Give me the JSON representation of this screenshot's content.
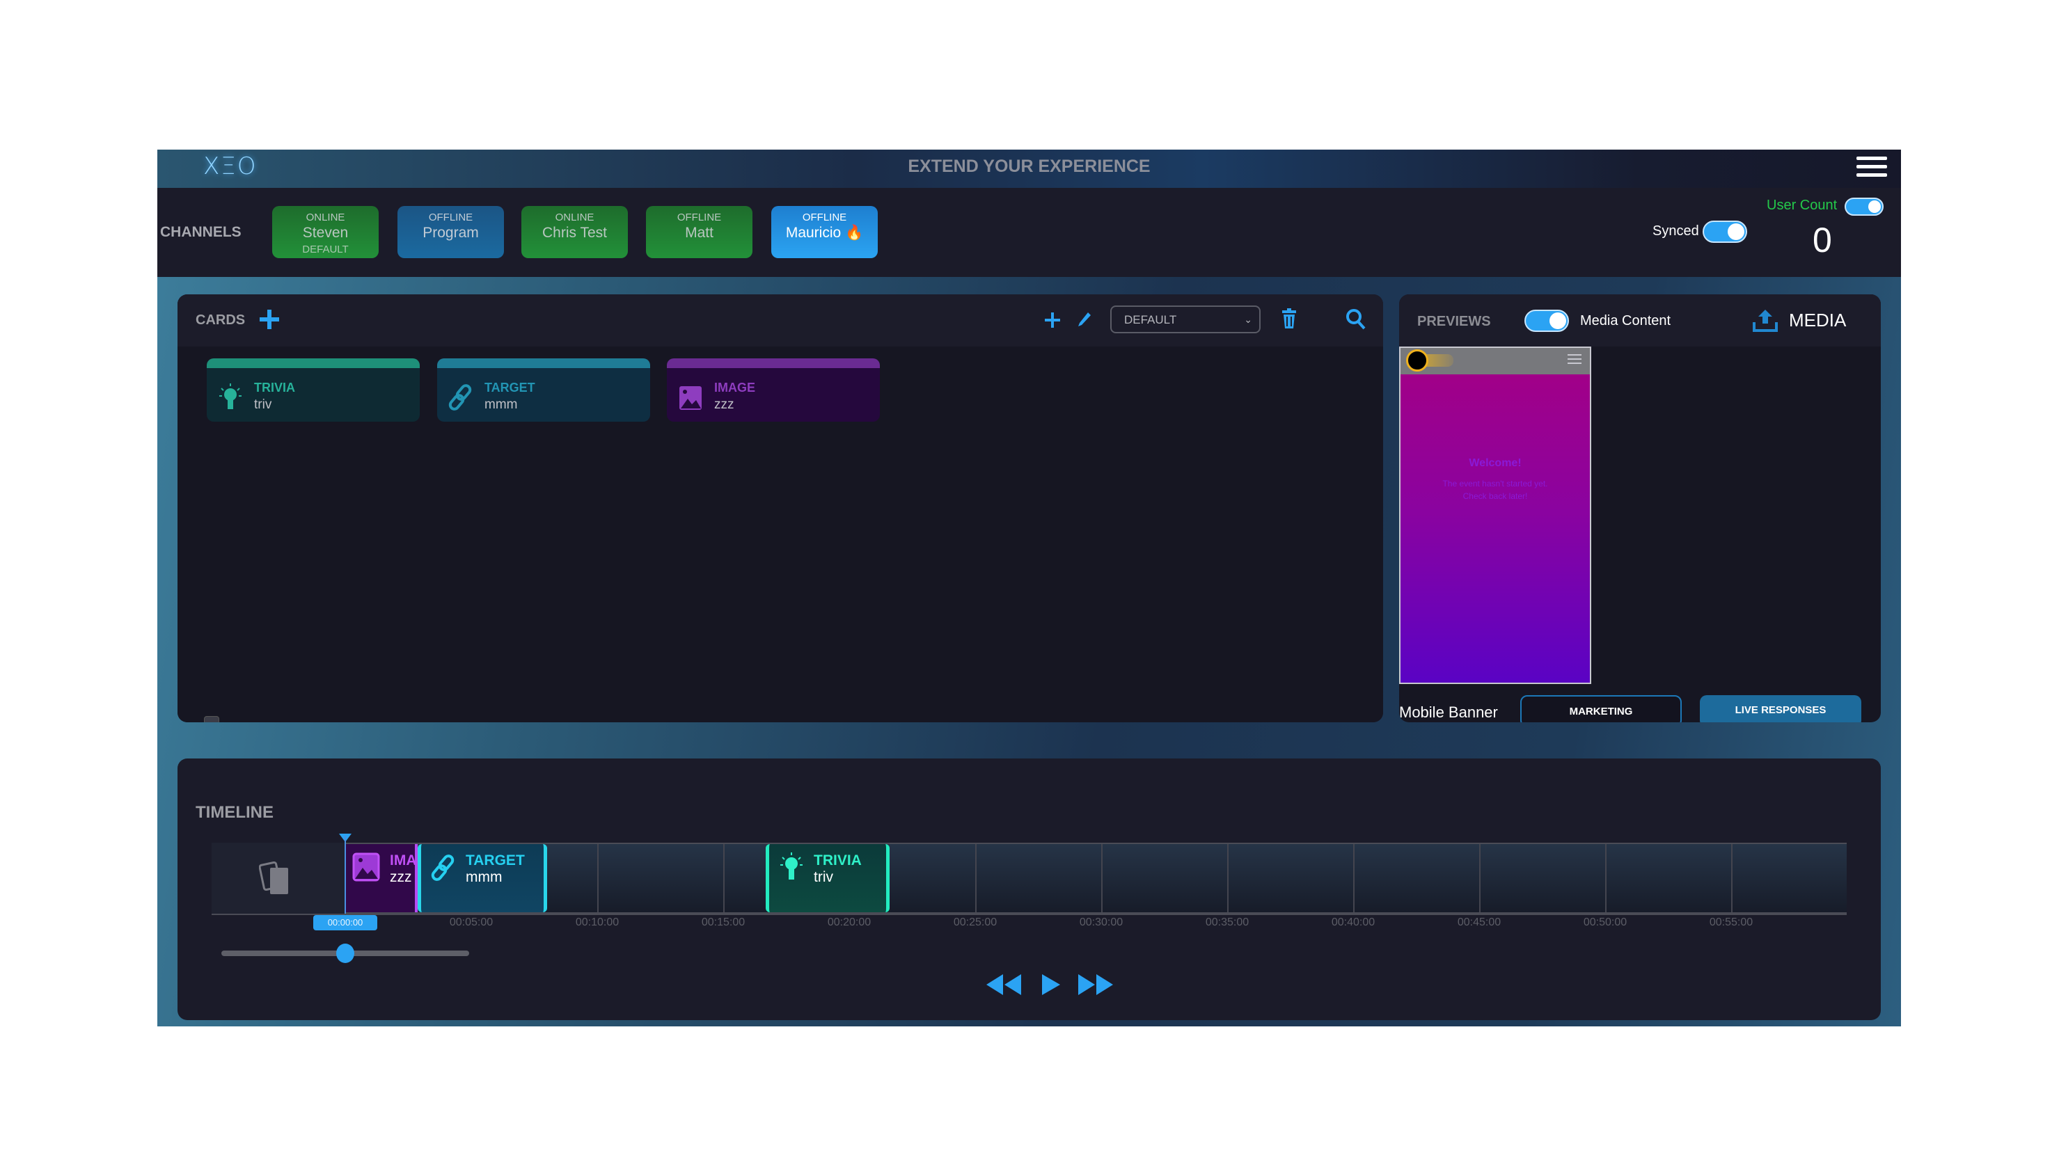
{
  "header": {
    "logo": "XΞO",
    "title": "EXTEND YOUR EXPERIENCE"
  },
  "channels": {
    "label": "CHANNELS",
    "items": [
      {
        "status": "ONLINE",
        "name": "Steven",
        "badge": "DEFAULT",
        "color": "green"
      },
      {
        "status": "OFFLINE",
        "name": "Program",
        "badge": "",
        "color": "blue"
      },
      {
        "status": "ONLINE",
        "name": "Chris Test",
        "badge": "",
        "color": "green"
      },
      {
        "status": "OFFLINE",
        "name": "Matt",
        "badge": "",
        "color": "green"
      },
      {
        "status": "OFFLINE",
        "name": "Mauricio 🔥",
        "badge": "",
        "color": "active"
      }
    ],
    "synced_label": "Synced",
    "synced_on": true,
    "user_count_label": "User Count",
    "user_count_on": true,
    "user_count_value": "0"
  },
  "cards": {
    "label": "CARDS",
    "select_value": "DEFAULT",
    "items": [
      {
        "type": "TRIVIA",
        "name": "triv",
        "icon": "lightbulb-icon"
      },
      {
        "type": "TARGET",
        "name": "mmm",
        "icon": "link-icon"
      },
      {
        "type": "IMAGE",
        "name": "zzz",
        "icon": "image-icon"
      }
    ]
  },
  "previews": {
    "label": "PREVIEWS",
    "media_content_label": "Media Content",
    "media_content_on": true,
    "media_label": "MEDIA",
    "phone": {
      "welcome": "Welcome!",
      "message_line1": "The event hasn't started yet.",
      "message_line2": "Check back later!"
    },
    "mobile_banner_label": "Mobile Banner",
    "marketing_label": "MARKETING",
    "live_responses_label": "LIVE RESPONSES"
  },
  "timeline": {
    "label": "TIMELINE",
    "current_time": "00:00:00",
    "ticks": [
      "00:05:00",
      "00:10:00",
      "00:15:00",
      "00:20:00",
      "00:25:00",
      "00:30:00",
      "00:35:00",
      "00:40:00",
      "00:45:00",
      "00:50:00",
      "00:55:00"
    ],
    "clips": [
      {
        "type": "IMAGE",
        "type_visible": "IMA",
        "name": "zzz",
        "kind": "image"
      },
      {
        "type": "TARGET",
        "name": "mmm",
        "kind": "target"
      },
      {
        "type": "TRIVIA",
        "name": "triv",
        "kind": "trivia"
      }
    ],
    "zoom_level": 0.5
  },
  "colors": {
    "accent": "#2ba3f3",
    "online": "#229139",
    "user_count": "#24c94a"
  }
}
